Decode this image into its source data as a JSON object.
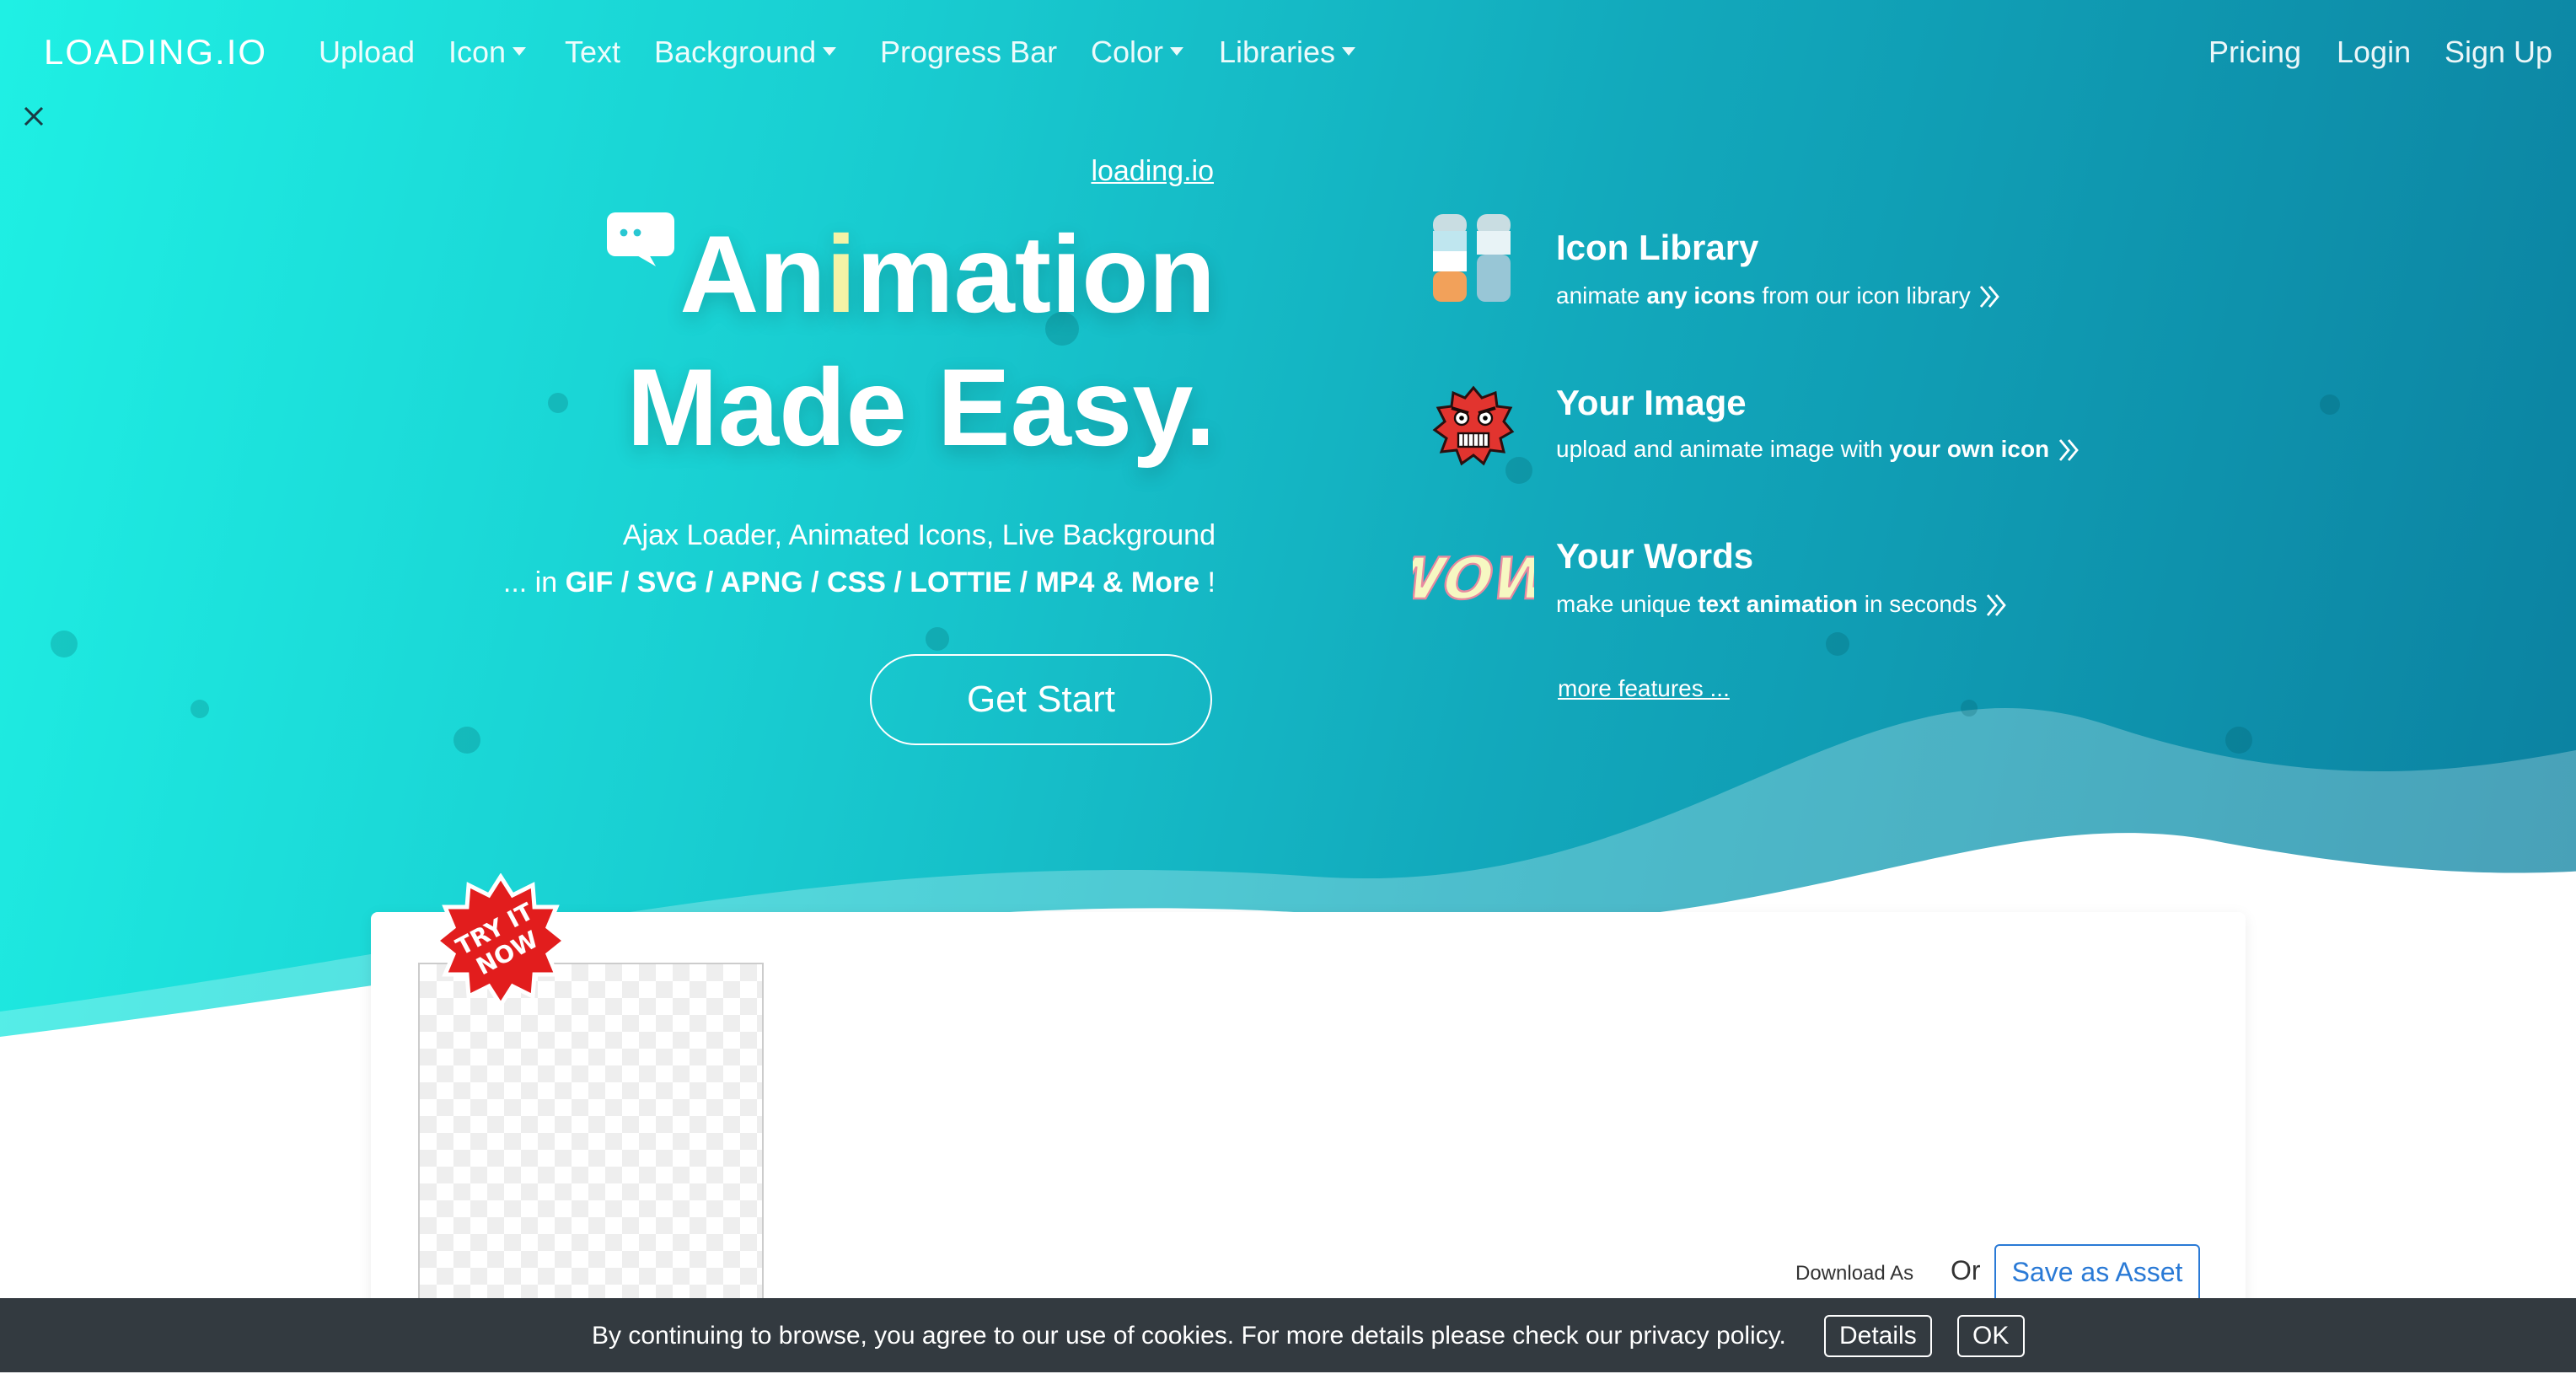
{
  "nav": {
    "brand": "LOADING.IO",
    "items": [
      "Upload",
      "Icon",
      "Text",
      "Background",
      "Progress Bar",
      "Color",
      "Libraries"
    ],
    "right": [
      "Pricing",
      "Login",
      "Sign Up"
    ]
  },
  "hero": {
    "site_link": "loading.io",
    "headline_pre": "An",
    "headline_i": "i",
    "headline_post": "mation",
    "headline2": "Made Easy.",
    "tagline1": "Ajax Loader, Animated Icons, Live Background",
    "tagline2_prefix": "... in ",
    "tagline2_formats": "GIF / SVG / APNG / CSS / LOTTIE / MP4 & More",
    "tagline2_suffix": " !",
    "cta": "Get Start"
  },
  "features": [
    {
      "title": "Icon Library",
      "desc_pre": "animate ",
      "desc_bold": "any icons",
      "desc_post": " from our icon library",
      "icon": "bottles-icon"
    },
    {
      "title": "Your Image",
      "desc_pre": "upload and animate image with ",
      "desc_bold": "your own icon",
      "desc_post": "",
      "icon": "angry-face-icon"
    },
    {
      "title": "Your Words",
      "desc_pre": "make unique ",
      "desc_bold": "text animation",
      "desc_post": " in seconds",
      "icon": "wow-text-icon"
    }
  ],
  "more_features": "more features ...",
  "badge": {
    "line1": "TRY IT",
    "line2": "NOW"
  },
  "wow_text": "WOW",
  "card": {
    "download_label": "Download As",
    "or_label": "Or",
    "save_button": "Save as Asset"
  },
  "cookie": {
    "text": "By continuing to browse, you agree to our use of cookies. For more details please check our privacy policy.",
    "details": "Details",
    "ok": "OK"
  }
}
